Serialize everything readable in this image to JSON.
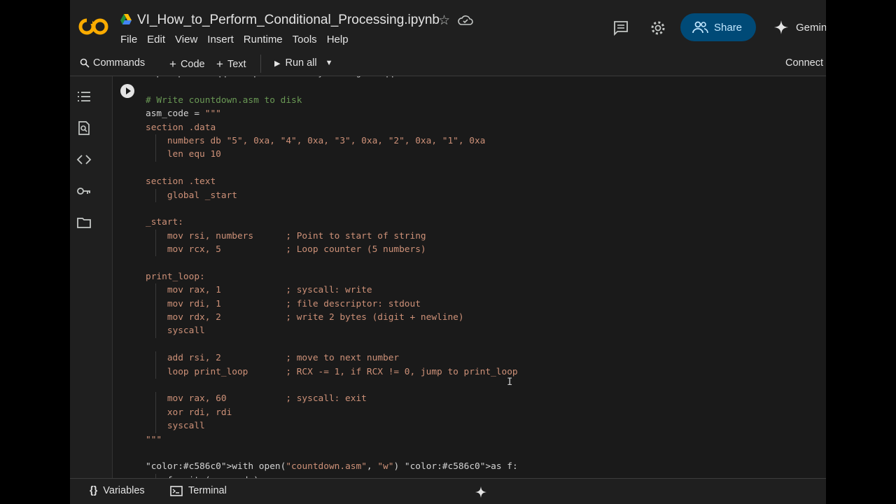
{
  "header": {
    "title": "VI_How_to_Perform_Conditional_Processing.ipynb",
    "menu": [
      "File",
      "Edit",
      "View",
      "Insert",
      "Runtime",
      "Tools",
      "Help"
    ],
    "share_label": "Share",
    "gemini_label": "Gemini"
  },
  "toolbar": {
    "commands_label": "Commands",
    "code_label": "Code",
    "text_label": "Text",
    "run_all_label": "Run all",
    "connect_label": "Connect"
  },
  "cell": {
    "lines": [
      "!apt update -qq && apt install -y nasm gcc -qq",
      "",
      "# Write countdown.asm to disk",
      "asm_code = \"\"\"",
      "section .data",
      "    numbers db \"5\", 0xa, \"4\", 0xa, \"3\", 0xa, \"2\", 0xa, \"1\", 0xa",
      "    len equ 10",
      "",
      "section .text",
      "    global _start",
      "",
      "_start:",
      "    mov rsi, numbers      ; Point to start of string",
      "    mov rcx, 5            ; Loop counter (5 numbers)",
      "",
      "print_loop:",
      "    mov rax, 1            ; syscall: write",
      "    mov rdi, 1            ; file descriptor: stdout",
      "    mov rdx, 2            ; write 2 bytes (digit + newline)",
      "    syscall",
      "",
      "    add rsi, 2            ; move to next number",
      "    loop print_loop       ; RCX -= 1, if RCX != 0, jump to print_loop",
      "",
      "    mov rax, 60           ; syscall: exit",
      "    xor rdi, rdi",
      "    syscall",
      "\"\"\"",
      "",
      "with open(\"countdown.asm\", \"w\") as f:",
      "    f.write(asm_code)"
    ]
  },
  "bottom": {
    "variables_label": "Variables",
    "terminal_label": "Terminal"
  },
  "colors": {
    "background": "#1f1f1f",
    "comment": "#6a9955",
    "string": "#ce9178",
    "keyword": "#c586c0",
    "share_bg": "#004a77"
  }
}
